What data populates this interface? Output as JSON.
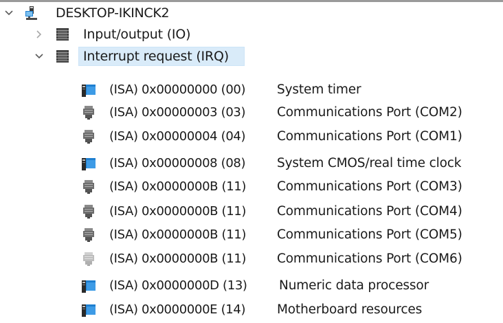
{
  "tree": {
    "root": {
      "label": "DESKTOP-IKINCK2",
      "expander_icon": "chevron-down-icon",
      "icon": "computer-icon"
    },
    "categories": [
      {
        "label": "Input/output (IO)",
        "expander_icon": "chevron-right-icon",
        "icon": "chip-icon",
        "expanded": false
      },
      {
        "label": "Interrupt request (IRQ)",
        "expander_icon": "chevron-down-icon",
        "icon": "chip-icon",
        "expanded": true,
        "selected": true
      }
    ],
    "items": [
      {
        "resource": "(ISA) 0x00000000 (00)",
        "device": "System timer",
        "icon": "system-device-icon"
      },
      {
        "resource": "(ISA) 0x00000003 (03)",
        "device": "Communications Port (COM2)",
        "icon": "port-connector-icon"
      },
      {
        "resource": "(ISA) 0x00000004 (04)",
        "device": "Communications Port (COM1)",
        "icon": "port-connector-icon"
      },
      {
        "resource": "(ISA) 0x00000008 (08)",
        "device": "System CMOS/real time clock",
        "icon": "system-device-icon"
      },
      {
        "resource": "(ISA) 0x0000000B (11)",
        "device": "Communications Port (COM3)",
        "icon": "port-connector-icon"
      },
      {
        "resource": "(ISA) 0x0000000B (11)",
        "device": "Communications Port (COM4)",
        "icon": "port-connector-icon"
      },
      {
        "resource": "(ISA) 0x0000000B (11)",
        "device": "Communications Port (COM5)",
        "icon": "port-connector-icon"
      },
      {
        "resource": "(ISA) 0x0000000B (11)",
        "device": "Communications Port (COM6)",
        "icon": "port-connector-disabled-icon"
      },
      {
        "resource": "(ISA) 0x0000000D (13)",
        "device": "Numeric data processor",
        "icon": "system-device-icon"
      },
      {
        "resource": "(ISA) 0x0000000E (14)",
        "device": "Motherboard resources",
        "icon": "system-device-icon"
      }
    ]
  },
  "colors": {
    "selection": "#d9ebf9",
    "selection_border": "#cce4f7",
    "text": "#1a1a1a",
    "chevron": "#5a5a5a",
    "chevron_dim": "#a8a8a8",
    "system_device_blue": "#1e7fd0",
    "port_gray": "#6e6e6e",
    "port_disabled": "#bdbdbd"
  }
}
